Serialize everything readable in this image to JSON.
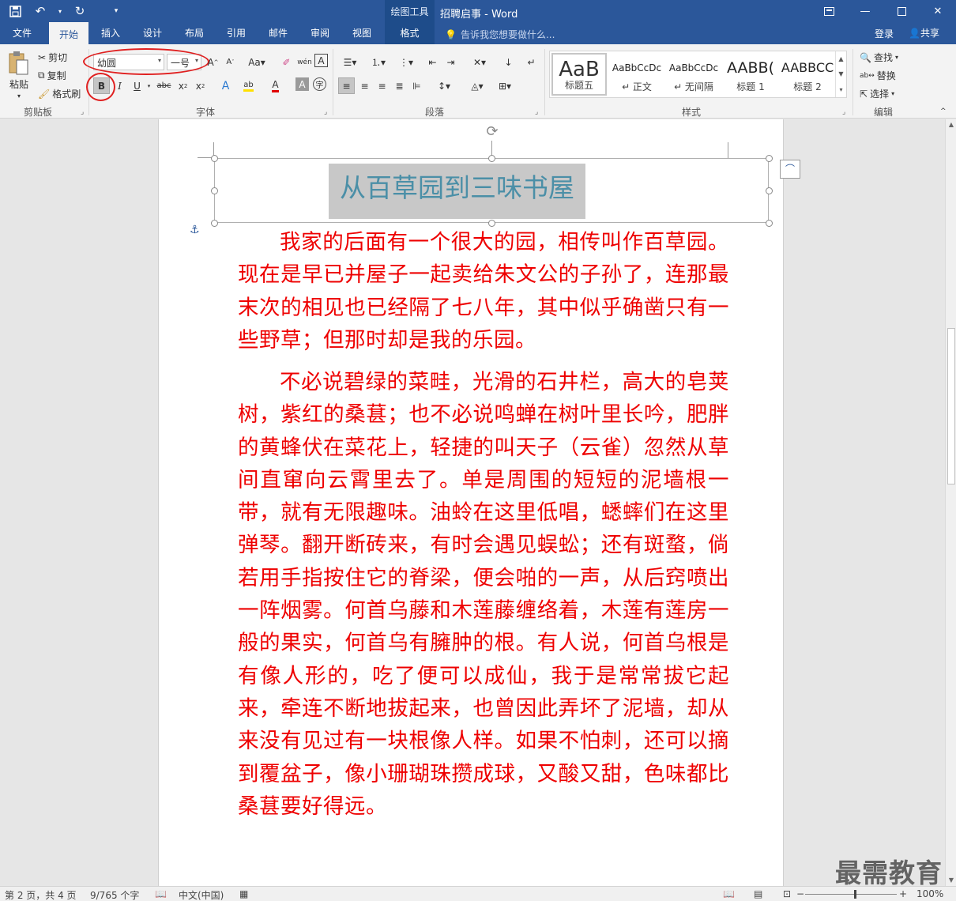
{
  "titlebar": {
    "context_tools": "绘图工具",
    "doc_title": "招聘启事 - Word"
  },
  "tabs": [
    {
      "label": "文件"
    },
    {
      "label": "开始"
    },
    {
      "label": "插入"
    },
    {
      "label": "设计"
    },
    {
      "label": "布局"
    },
    {
      "label": "引用"
    },
    {
      "label": "邮件"
    },
    {
      "label": "审阅"
    },
    {
      "label": "视图"
    },
    {
      "label": "格式"
    }
  ],
  "tell_me": "告诉我您想要做什么...",
  "login": "登录",
  "share": "共享",
  "clipboard": {
    "paste": "粘贴",
    "cut": "剪切",
    "copy": "复制",
    "format_painter": "格式刷",
    "label": "剪贴板"
  },
  "font": {
    "font_name": "幼圆",
    "font_size": "一号",
    "label": "字体"
  },
  "paragraph": {
    "label": "段落"
  },
  "styles": {
    "label": "样式",
    "items": [
      {
        "preview": "AaB",
        "name": "标题五"
      },
      {
        "preview": "AaBbCcDc",
        "name": "↵ 正文"
      },
      {
        "preview": "AaBbCcDc",
        "name": "↵ 无间隔"
      },
      {
        "preview": "AABB(",
        "name": "标题 1"
      },
      {
        "preview": "AABBCC",
        "name": "标题 2"
      }
    ]
  },
  "editing": {
    "find": "查找",
    "replace": "替换",
    "select": "选择",
    "label": "编辑"
  },
  "document": {
    "heading": "从百草园到三味书屋",
    "paragraphs": [
      "我家的后面有一个很大的园，相传叫作百草园。现在是早已并屋子一起卖给朱文公的子孙了，连那最末次的相见也已经隔了七八年，其中似乎确凿只有一些野草；但那时却是我的乐园。",
      "不必说碧绿的菜畦，光滑的石井栏，高大的皂荚树，紫红的桑葚；也不必说鸣蝉在树叶里长吟，肥胖的黄蜂伏在菜花上，轻捷的叫天子（云雀）忽然从草间直窜向云霄里去了。单是周围的短短的泥墙根一带，就有无限趣味。油蛉在这里低唱，蟋蟀们在这里弹琴。翻开断砖来，有时会遇见蜈蚣；还有斑蝥，倘若用手指按住它的脊梁，便会啪的一声，从后窍喷出一阵烟雾。何首乌藤和木莲藤缠络着，木莲有莲房一般的果实，何首乌有臃肿的根。有人说，何首乌根是有像人形的，吃了便可以成仙，我于是常常拔它起来，牵连不断地拔起来，也曾因此弄坏了泥墙，却从来没有见过有一块根像人样。如果不怕刺，还可以摘到覆盆子，像小珊瑚珠攒成球，又酸又甜，色味都比桑葚要好得远。"
    ]
  },
  "status": {
    "page": "第 2 页，共 4 页",
    "words": "9/765 个字",
    "language": "中文(中国)",
    "zoom": "100%"
  },
  "watermark": "最需教育",
  "colors": {
    "accent": "#2b579a",
    "body_text": "#ee0000",
    "heading_text": "#4b8fa7",
    "annotation": "#e02020"
  }
}
